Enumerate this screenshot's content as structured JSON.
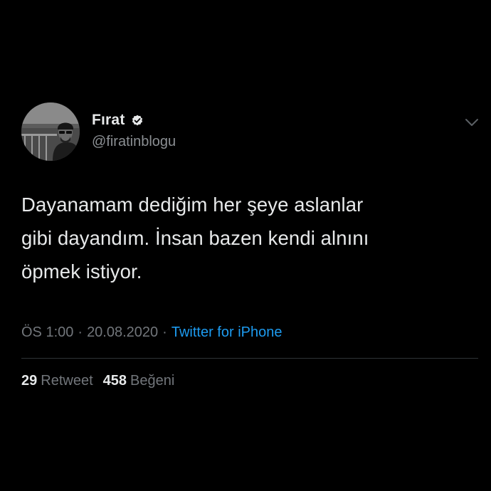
{
  "tweet": {
    "author": {
      "display_name": "Fırat",
      "handle": "@firatinblogu",
      "verified": true,
      "avatar_icon": "profile-photo"
    },
    "menu_icon": "chevron-down-icon",
    "text": "Dayanamam dediğim her şeye aslanlar\ngibi dayandım. İnsan bazen kendi alnını\nöpmek istiyor.",
    "time": "ÖS 1:00",
    "date": "20.08.2020",
    "separator": "·",
    "source": "Twitter for iPhone",
    "stats": {
      "retweets_count": "29",
      "retweets_label": "Retweet",
      "likes_count": "458",
      "likes_label": "Beğeni"
    }
  },
  "colors": {
    "background": "#000000",
    "primary_text": "#e7e9ea",
    "secondary_text": "#72767b",
    "link": "#1d9bf0",
    "divider": "#2f3336"
  }
}
